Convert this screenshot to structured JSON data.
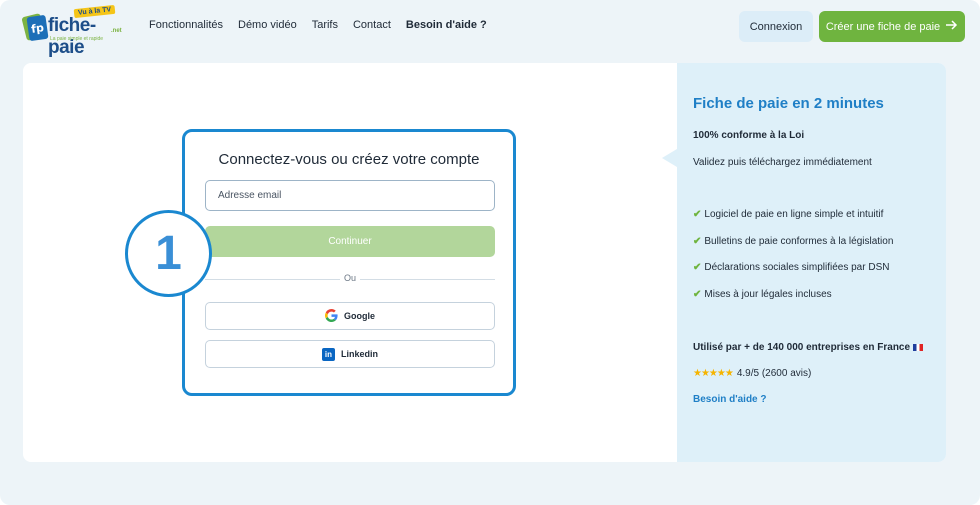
{
  "header": {
    "logo_text": "fiche-paie",
    "logo_tld": ".net",
    "logo_tagline": "La paie simple et rapide",
    "logo_badge": "Vu à la TV",
    "nav": [
      {
        "label": "Fonctionnalités"
      },
      {
        "label": "Démo vidéo"
      },
      {
        "label": "Tarifs"
      },
      {
        "label": "Contact"
      },
      {
        "label": "Besoin d'aide ?"
      }
    ],
    "login_label": "Connexion",
    "create_label": "Créer une fiche de paie",
    "create_icon": "arrow-right-icon"
  },
  "login": {
    "heading": "Connectez-vous ou créez votre compte",
    "email_placeholder": "Adresse email",
    "continue_label": "Continuer",
    "or_label": "Ou",
    "google_label": "Google",
    "linkedin_label": "Linkedin"
  },
  "step_number": "1",
  "side": {
    "title": "Fiche de paie en 2 minutes",
    "conformity": "100% conforme à la Loi",
    "validate": "Validez puis téléchargez immédiatement",
    "features": [
      "Logiciel de paie en ligne simple et intuitif",
      "Bulletins de paie conformes à la législation",
      "Déclarations sociales simplifiées par DSN",
      "Mises à jour légales incluses"
    ],
    "used_by": "Utilisé par + de 140 000 entreprises en France",
    "stars": "★★★★★",
    "rating": "4.9/5 (2600 avis)",
    "help": "Besoin d'aide ?"
  },
  "colors": {
    "accent_blue": "#1a88d0",
    "accent_green": "#6fb43f",
    "side_bg": "#def0f9"
  }
}
